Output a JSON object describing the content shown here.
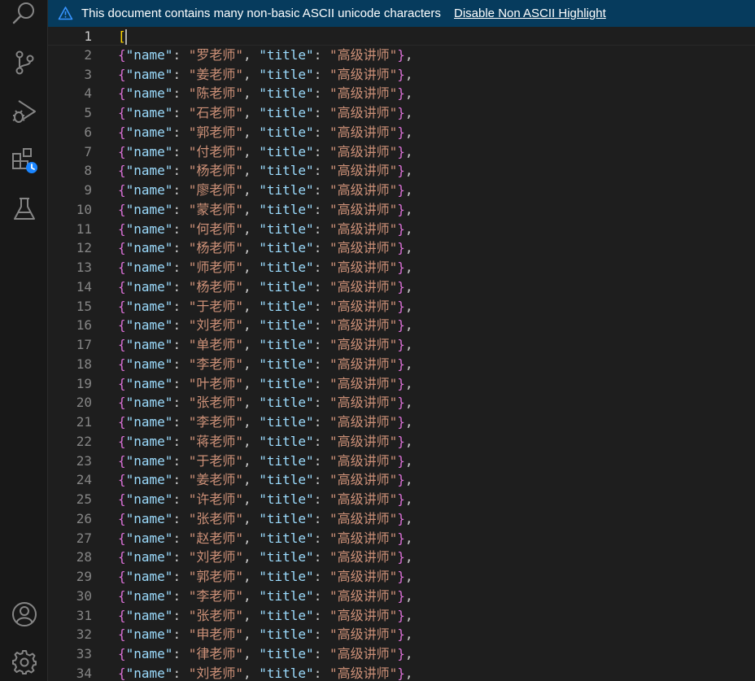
{
  "banner": {
    "message": "This document contains many non-basic ASCII unicode characters",
    "action_label": "Disable Non ASCII Highlight"
  },
  "activity_bar": {
    "items": [
      "search-icon",
      "source-control-icon",
      "run-debug-icon",
      "extensions-icon",
      "testing-icon"
    ],
    "bottom_items": [
      "accounts-icon",
      "settings-gear-icon"
    ]
  },
  "colors": {
    "banner_bg": "#063b5d",
    "editor_bg": "#1e1e1e",
    "key": "#9cdcfe",
    "string": "#ce9178",
    "brace": "#da70d6",
    "bracket": "#ffd700"
  },
  "editor": {
    "first_line": {
      "number": "1",
      "text": "["
    },
    "key_name": "\"name\"",
    "key_title": "\"title\"",
    "lines": [
      {
        "number": "2",
        "name": "\"罗老师\"",
        "title": "\"高级讲师\""
      },
      {
        "number": "3",
        "name": "\"姜老师\"",
        "title": "\"高级讲师\""
      },
      {
        "number": "4",
        "name": "\"陈老师\"",
        "title": "\"高级讲师\""
      },
      {
        "number": "5",
        "name": "\"石老师\"",
        "title": "\"高级讲师\""
      },
      {
        "number": "6",
        "name": "\"郭老师\"",
        "title": "\"高级讲师\""
      },
      {
        "number": "7",
        "name": "\"付老师\"",
        "title": "\"高级讲师\""
      },
      {
        "number": "8",
        "name": "\"杨老师\"",
        "title": "\"高级讲师\""
      },
      {
        "number": "9",
        "name": "\"廖老师\"",
        "title": "\"高级讲师\""
      },
      {
        "number": "10",
        "name": "\"蒙老师\"",
        "title": "\"高级讲师\""
      },
      {
        "number": "11",
        "name": "\"何老师\"",
        "title": "\"高级讲师\""
      },
      {
        "number": "12",
        "name": "\"杨老师\"",
        "title": "\"高级讲师\""
      },
      {
        "number": "13",
        "name": "\"师老师\"",
        "title": "\"高级讲师\""
      },
      {
        "number": "14",
        "name": "\"杨老师\"",
        "title": "\"高级讲师\""
      },
      {
        "number": "15",
        "name": "\"于老师\"",
        "title": "\"高级讲师\""
      },
      {
        "number": "16",
        "name": "\"刘老师\"",
        "title": "\"高级讲师\""
      },
      {
        "number": "17",
        "name": "\"单老师\"",
        "title": "\"高级讲师\""
      },
      {
        "number": "18",
        "name": "\"李老师\"",
        "title": "\"高级讲师\""
      },
      {
        "number": "19",
        "name": "\"叶老师\"",
        "title": "\"高级讲师\""
      },
      {
        "number": "20",
        "name": "\"张老师\"",
        "title": "\"高级讲师\""
      },
      {
        "number": "21",
        "name": "\"李老师\"",
        "title": "\"高级讲师\""
      },
      {
        "number": "22",
        "name": "\"蒋老师\"",
        "title": "\"高级讲师\""
      },
      {
        "number": "23",
        "name": "\"于老师\"",
        "title": "\"高级讲师\""
      },
      {
        "number": "24",
        "name": "\"姜老师\"",
        "title": "\"高级讲师\""
      },
      {
        "number": "25",
        "name": "\"许老师\"",
        "title": "\"高级讲师\""
      },
      {
        "number": "26",
        "name": "\"张老师\"",
        "title": "\"高级讲师\""
      },
      {
        "number": "27",
        "name": "\"赵老师\"",
        "title": "\"高级讲师\""
      },
      {
        "number": "28",
        "name": "\"刘老师\"",
        "title": "\"高级讲师\""
      },
      {
        "number": "29",
        "name": "\"郭老师\"",
        "title": "\"高级讲师\""
      },
      {
        "number": "30",
        "name": "\"李老师\"",
        "title": "\"高级讲师\""
      },
      {
        "number": "31",
        "name": "\"张老师\"",
        "title": "\"高级讲师\""
      },
      {
        "number": "32",
        "name": "\"申老师\"",
        "title": "\"高级讲师\""
      },
      {
        "number": "33",
        "name": "\"律老师\"",
        "title": "\"高级讲师\""
      },
      {
        "number": "34",
        "name": "\"刘老师\"",
        "title": "\"高级讲师\""
      }
    ]
  }
}
